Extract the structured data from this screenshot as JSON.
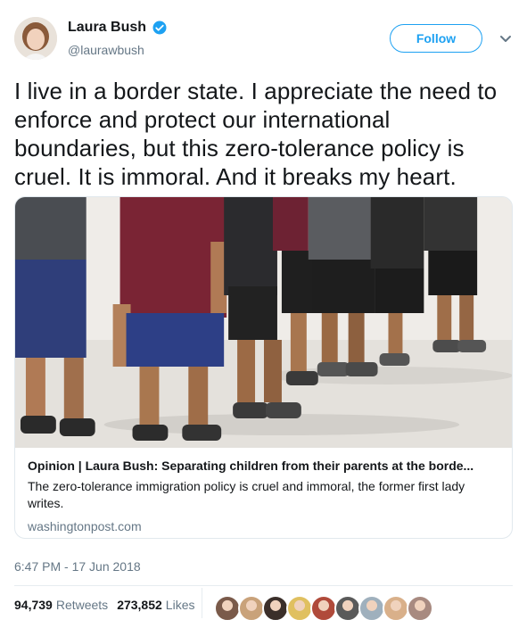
{
  "author": {
    "name": "Laura Bush",
    "handle": "@laurawbush",
    "verified": true,
    "avatar_icon": "profile-photo"
  },
  "follow_label": "Follow",
  "menu_icon": "chevron-down-icon",
  "tweet": {
    "text": "I live in a border state. I appreciate the need to enforce and protect our international boundaries, but this zero-tolerance policy is cruel. It is immoral. And it breaks my heart."
  },
  "card": {
    "image_icon": "photo-children-lined-up",
    "title": "Opinion | Laura Bush: Separating children from their parents at the borde...",
    "description": "The zero-tolerance immigration policy is cruel and immoral, the former first lady writes.",
    "domain": "washingtonpost.com"
  },
  "timestamp": "6:47 PM - 17 Jun 2018",
  "stats": {
    "retweets_count": "94,739",
    "retweets_label": "Retweets",
    "likes_count": "273,852",
    "likes_label": "Likes"
  },
  "likers": [
    {
      "icon": "liker-avatar",
      "color": "#7a5a4a"
    },
    {
      "icon": "liker-avatar",
      "color": "#c9a27a"
    },
    {
      "icon": "liker-avatar",
      "color": "#3b2f2a"
    },
    {
      "icon": "liker-avatar",
      "color": "#e0c060"
    },
    {
      "icon": "liker-avatar",
      "color": "#b04a3a"
    },
    {
      "icon": "liker-avatar",
      "color": "#5a5a5a"
    },
    {
      "icon": "liker-avatar",
      "color": "#9fb0bd"
    },
    {
      "icon": "liker-avatar",
      "color": "#d9b08a"
    },
    {
      "icon": "liker-avatar",
      "color": "#a88a80"
    }
  ]
}
